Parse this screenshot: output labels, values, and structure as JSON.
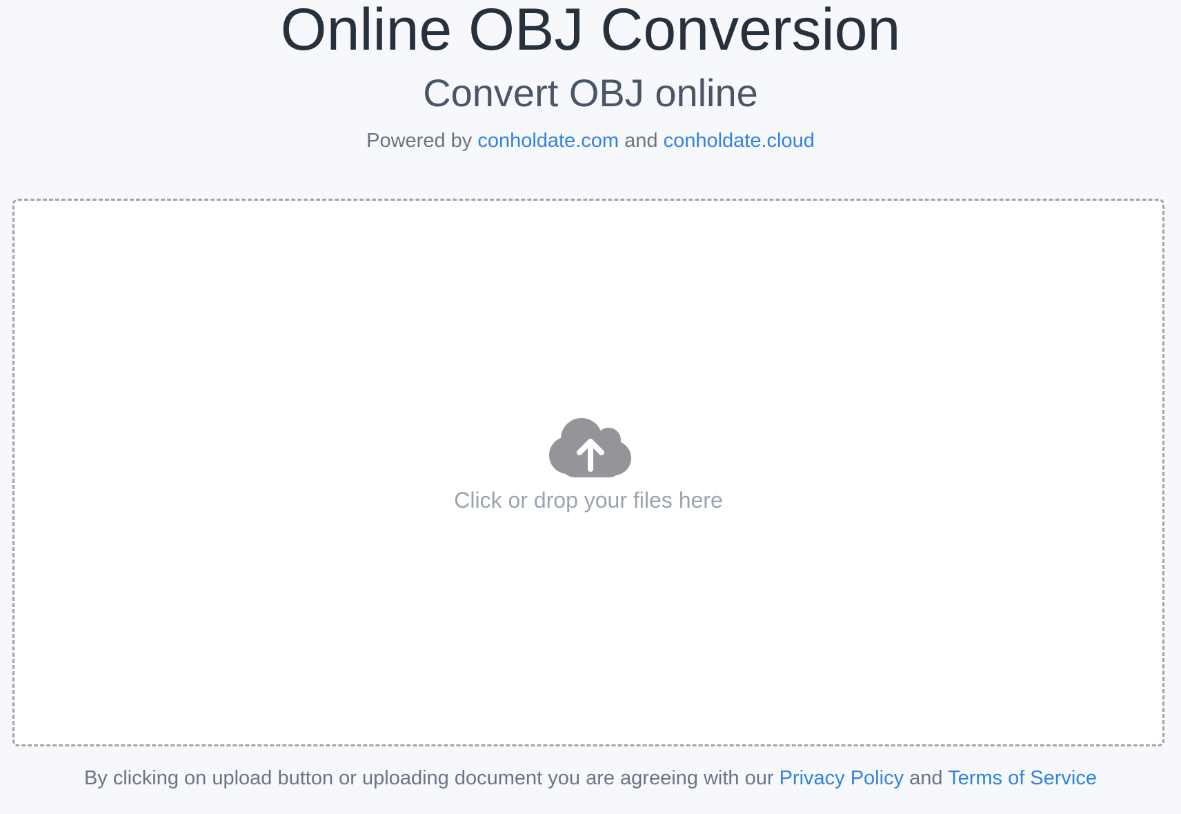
{
  "header": {
    "title": "Online OBJ Conversion",
    "subtitle": "Convert OBJ online",
    "powered_prefix": "Powered by ",
    "powered_link1": "conholdate.com",
    "powered_and": " and ",
    "powered_link2": "conholdate.cloud"
  },
  "upload": {
    "icon": "cloud-upload-icon",
    "text": "Click or drop your files here"
  },
  "footer": {
    "agreement_prefix": "By clicking on upload button or uploading document you are agreeing with our ",
    "privacy_link": "Privacy Policy",
    "and": " and ",
    "terms_link": "Terms of Service"
  },
  "colors": {
    "background": "#f6f8fb",
    "title": "#27313b",
    "subtitle": "#4a5566",
    "link": "#3183e0",
    "icon": "#939598",
    "drop_text": "#9aa3b0",
    "dropzone_border": "#a0a4aa"
  }
}
